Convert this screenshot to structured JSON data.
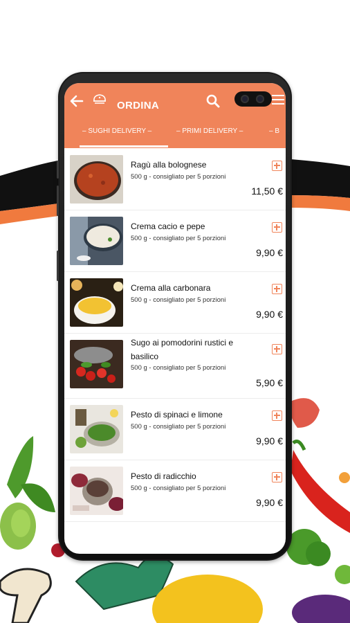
{
  "app": {
    "title": "ORDINA"
  },
  "tabs": [
    {
      "label": "– SUGHI DELIVERY –"
    },
    {
      "label": "– PRIMI DELIVERY –"
    },
    {
      "label": "– B"
    }
  ],
  "products": [
    {
      "name": "Ragù alla bolognese",
      "desc": "500 g - consigliato per 5 porzioni",
      "price": "11,50 €"
    },
    {
      "name": "Crema cacio e pepe",
      "desc": "500 g - consigliato per 5 porzioni",
      "price": "9,90 €"
    },
    {
      "name": "Crema alla carbonara",
      "desc": "500 g - consigliato per 5 porzioni",
      "price": "9,90 €"
    },
    {
      "name": "Sugo ai pomodorini rustici e basilico",
      "desc": "500 g - consigliato per 5 porzioni",
      "price": "5,90 €"
    },
    {
      "name": "Pesto di spinaci e limone",
      "desc": "500 g - consigliato per 5 porzioni",
      "price": "9,90 €"
    },
    {
      "name": "Pesto di radicchio",
      "desc": "500 g - consigliato per 5 porzioni",
      "price": "9,90 €"
    }
  ],
  "colors": {
    "accent": "#f0845a",
    "stripe_black": "#111111",
    "stripe_orange": "#f07a3e"
  },
  "icons": [
    "back-arrow-icon",
    "logo-icon",
    "search-icon",
    "menu-icon",
    "add-icon"
  ]
}
